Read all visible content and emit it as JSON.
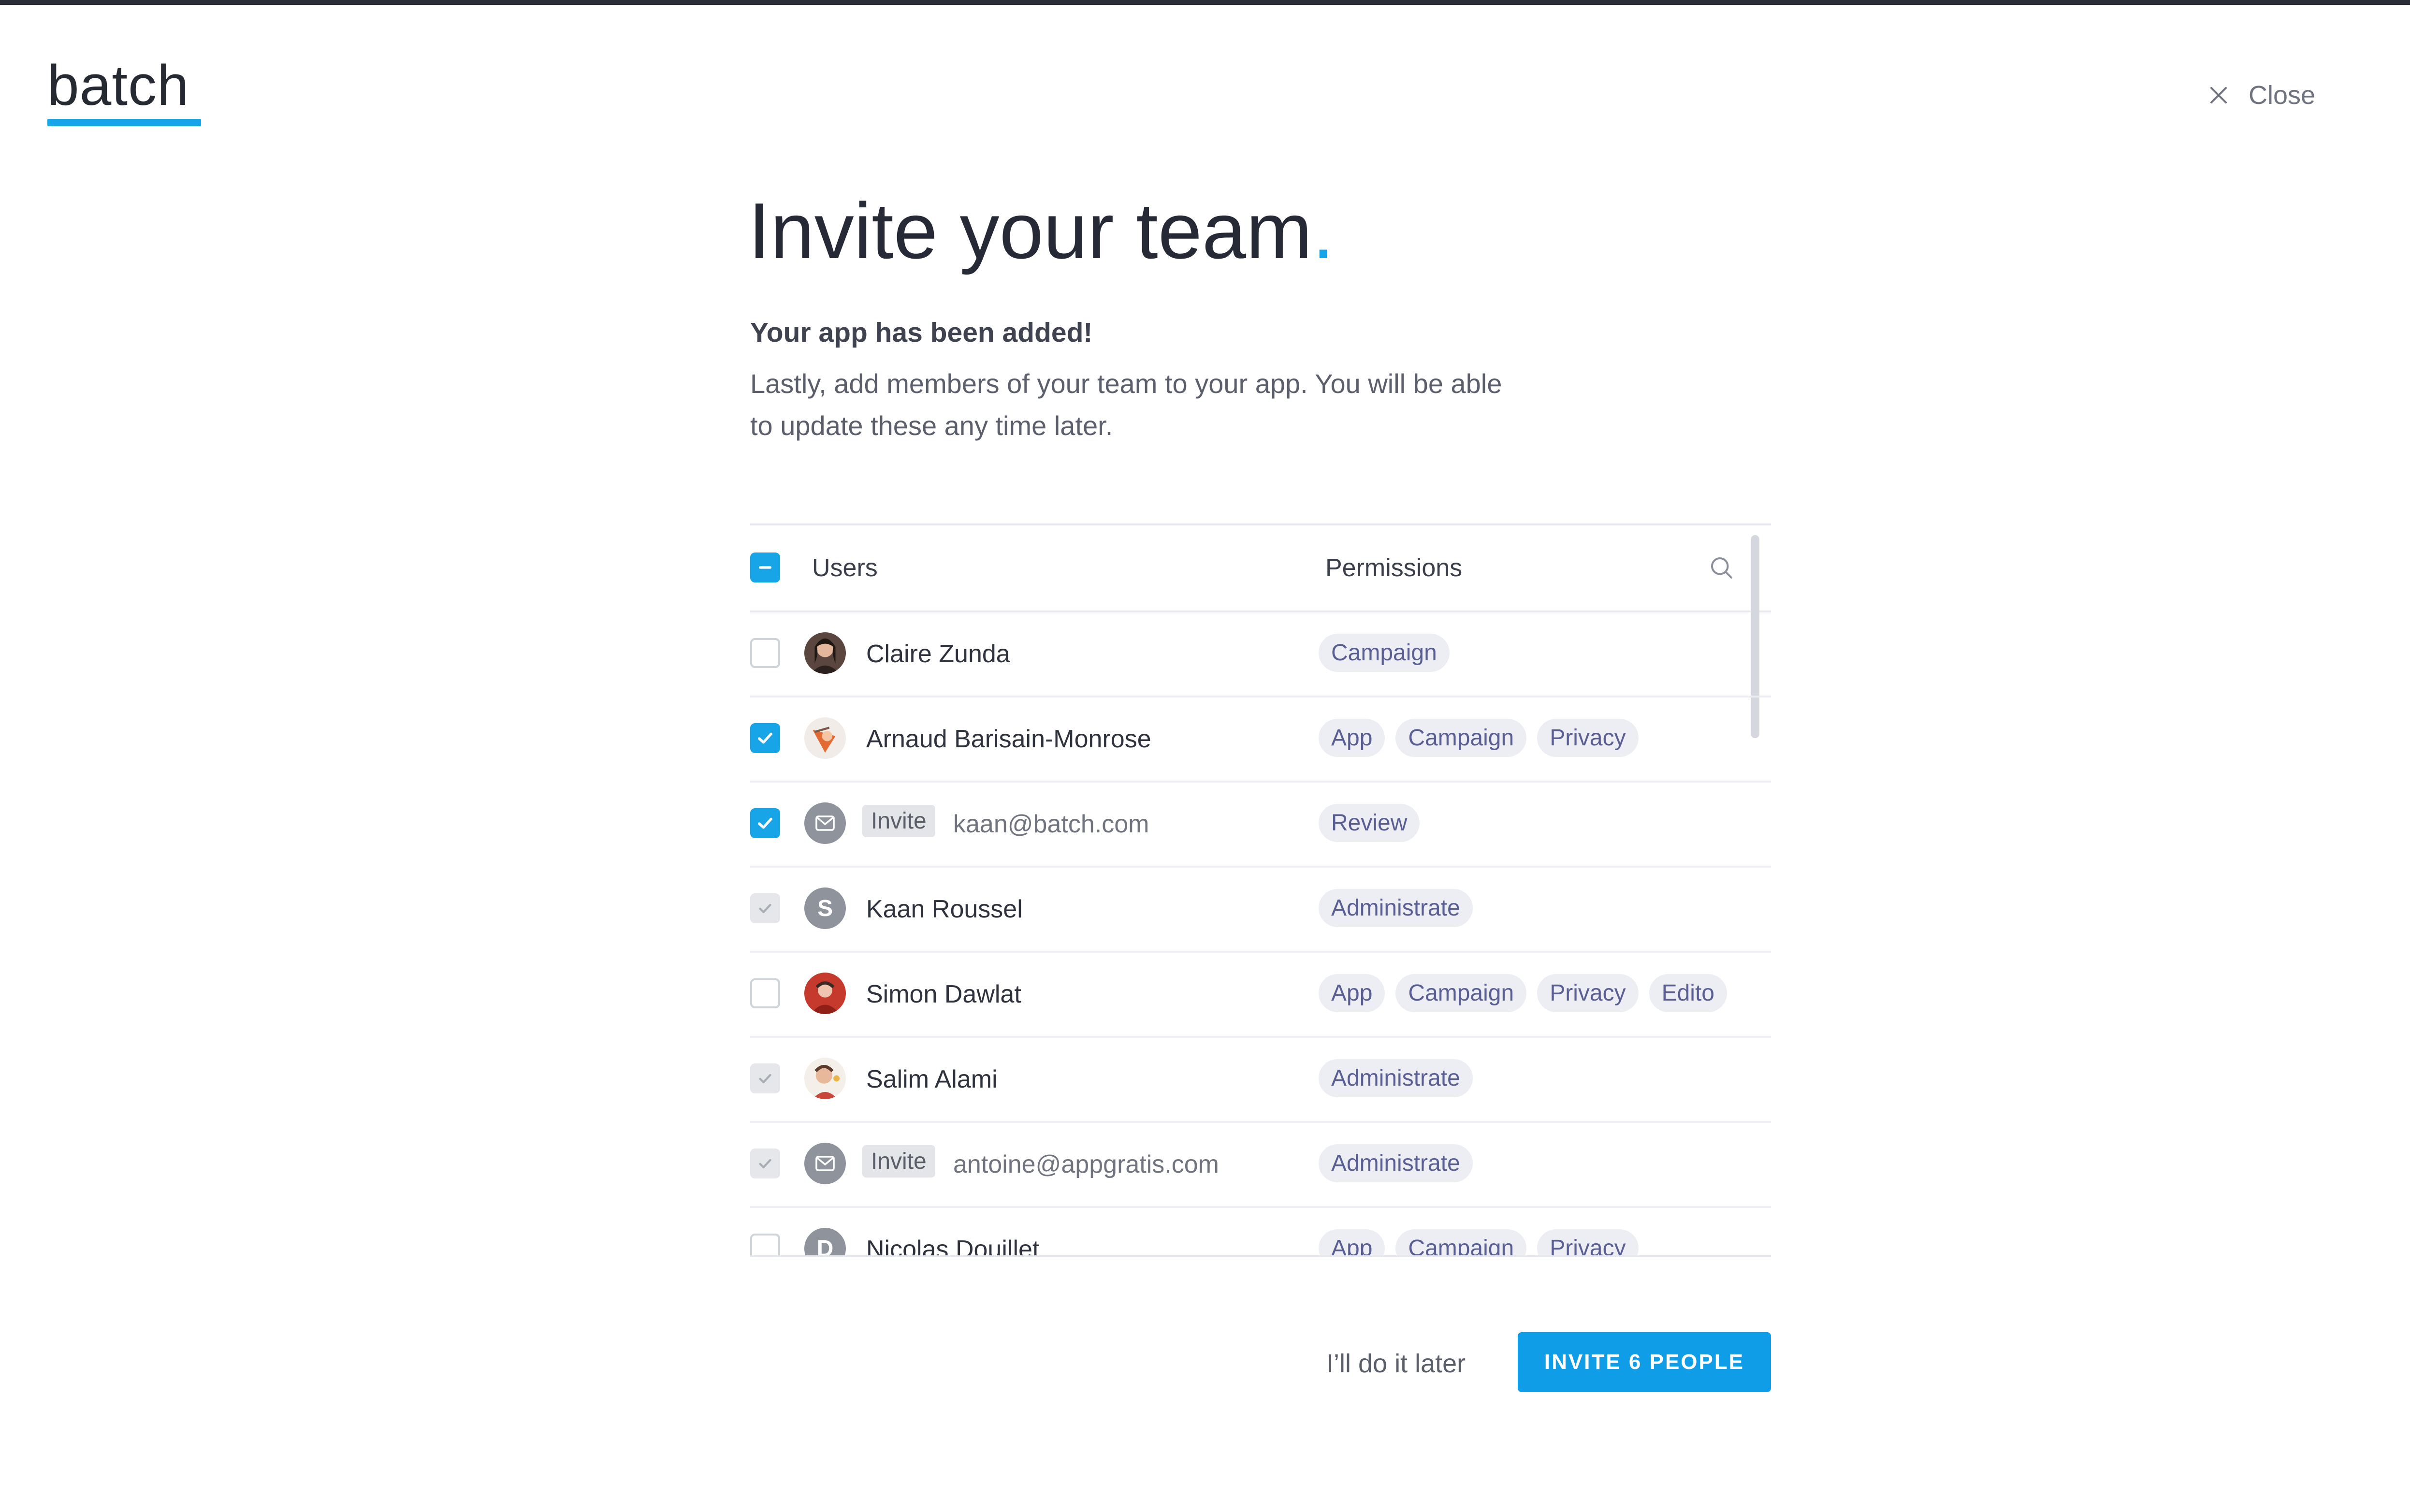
{
  "brand": {
    "logo_text": "batch",
    "accent": "#17a5e8"
  },
  "header": {
    "close_label": "Close"
  },
  "main": {
    "title": "Invite your team",
    "title_punctuation": ".",
    "subtitle": "Your app has been added!",
    "description": "Lastly, add members of your team to your app. You will be able to update these any time later."
  },
  "table": {
    "select_all_state": "indeterminate",
    "col_users": "Users",
    "col_permissions": "Permissions",
    "search_icon": "search-icon",
    "rows": [
      {
        "type": "user",
        "checkbox": "unchecked",
        "avatar": "photo",
        "name": "Claire Zunda",
        "permissions": [
          "Campaign"
        ]
      },
      {
        "type": "user",
        "checkbox": "checked",
        "avatar": "photo",
        "name": "Arnaud Barisain-Monrose",
        "permissions": [
          "App",
          "Campaign",
          "Privacy"
        ]
      },
      {
        "type": "invite",
        "checkbox": "checked",
        "avatar": "mail-icon",
        "invite_label": "Invite",
        "email": "kaan@batch.com",
        "permissions": [
          "Review"
        ]
      },
      {
        "type": "user",
        "checkbox": "disabled",
        "avatar": "initial",
        "initial": "S",
        "name": "Kaan Roussel",
        "permissions": [
          "Administrate"
        ]
      },
      {
        "type": "user",
        "checkbox": "unchecked",
        "avatar": "photo",
        "name": "Simon Dawlat",
        "permissions": [
          "App",
          "Campaign",
          "Privacy",
          "Edito"
        ]
      },
      {
        "type": "user",
        "checkbox": "disabled",
        "avatar": "photo",
        "name": "Salim Alami",
        "permissions": [
          "Administrate"
        ]
      },
      {
        "type": "invite",
        "checkbox": "disabled",
        "avatar": "mail-icon",
        "invite_label": "Invite",
        "email": "antoine@appgratis.com",
        "permissions": [
          "Administrate"
        ]
      },
      {
        "type": "user",
        "checkbox": "unchecked",
        "avatar": "initial",
        "initial": "D",
        "name": "Nicolas Douillet",
        "permissions": [
          "App",
          "Campaign",
          "Privacy"
        ]
      }
    ]
  },
  "footer": {
    "later_label": "I’ll do it later",
    "invite_button_label": "INVITE 6 PEOPLE"
  }
}
